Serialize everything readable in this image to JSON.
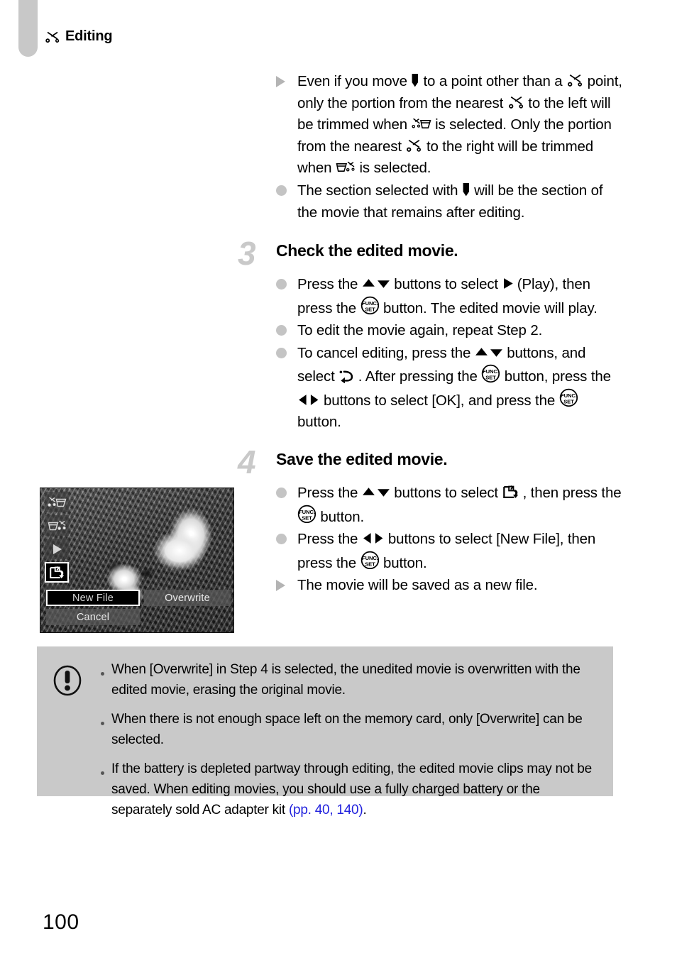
{
  "header": {
    "chapter_title": "Editing",
    "chapter_icon": "scissors-icon"
  },
  "body": {
    "note_bullets": [
      {
        "marker": "triangle",
        "segments": [
          {
            "t": "Even if you move "
          },
          {
            "icon": "cursor-marker-icon"
          },
          {
            "t": " to a point other than a "
          },
          {
            "icon": "scissors-icon"
          },
          {
            "t": " point, only the portion from the nearest "
          },
          {
            "icon": "scissors-icon"
          },
          {
            "t": " to the left will be trimmed when "
          },
          {
            "icon": "trim-beginning-icon"
          },
          {
            "t": " is selected. Only the portion from the nearest "
          },
          {
            "icon": "scissors-icon"
          },
          {
            "t": " to the right will be trimmed when "
          },
          {
            "icon": "trim-end-icon"
          },
          {
            "t": " is selected."
          }
        ]
      },
      {
        "marker": "dot",
        "segments": [
          {
            "t": "The section selected with "
          },
          {
            "icon": "cursor-marker-icon"
          },
          {
            "t": " will be the section of the movie that remains after editing."
          }
        ]
      }
    ]
  },
  "steps": [
    {
      "number": "3",
      "title": "Check the edited movie.",
      "bullets": [
        {
          "marker": "dot",
          "segments": [
            {
              "t": "Press the "
            },
            {
              "icon": "up-down-buttons-icon"
            },
            {
              "t": " buttons to select "
            },
            {
              "icon": "play-icon"
            },
            {
              "t": " (Play), then press the "
            },
            {
              "icon": "func-set-button-icon"
            },
            {
              "t": " button. The edited movie will play."
            }
          ]
        },
        {
          "marker": "dot",
          "segments": [
            {
              "t": "To edit the movie again, repeat Step 2."
            }
          ]
        },
        {
          "marker": "dot",
          "segments": [
            {
              "t": "To cancel editing, press the "
            },
            {
              "icon": "up-down-buttons-icon"
            },
            {
              "t": " buttons, and select "
            },
            {
              "icon": "return-arrow-icon"
            },
            {
              "t": " . After pressing the "
            },
            {
              "icon": "func-set-button-icon"
            },
            {
              "t": " button, press the "
            },
            {
              "icon": "left-right-buttons-icon"
            },
            {
              "t": " buttons to select [OK], and press the "
            },
            {
              "icon": "func-set-button-icon"
            },
            {
              "t": " button."
            }
          ]
        }
      ]
    },
    {
      "number": "4",
      "title": "Save the edited movie.",
      "bullets": [
        {
          "marker": "dot",
          "segments": [
            {
              "t": "Press the "
            },
            {
              "icon": "up-down-buttons-icon"
            },
            {
              "t": " buttons to select "
            },
            {
              "icon": "save-new-file-icon"
            },
            {
              "t": " , then press the "
            },
            {
              "icon": "func-set-button-icon"
            },
            {
              "t": " button."
            }
          ]
        },
        {
          "marker": "dot",
          "segments": [
            {
              "t": "Press the "
            },
            {
              "icon": "left-right-buttons-icon"
            },
            {
              "t": " buttons to select [New File], then press the "
            },
            {
              "icon": "func-set-button-icon"
            },
            {
              "t": " button."
            }
          ]
        },
        {
          "marker": "triangle",
          "segments": [
            {
              "t": "The movie will be saved as a new file."
            }
          ]
        }
      ]
    }
  ],
  "lcd_screen": {
    "icon_menu": [
      {
        "name": "trim-beginning-icon",
        "selected": false
      },
      {
        "name": "trim-end-icon",
        "selected": false
      },
      {
        "name": "play-icon",
        "selected": false
      },
      {
        "name": "save-new-file-icon",
        "selected": true
      },
      {
        "name": "return-arrow-icon",
        "selected": false
      }
    ],
    "buttons": {
      "new_file": "New File",
      "overwrite": "Overwrite",
      "cancel": "Cancel"
    },
    "photo_description": "Grayscale photo of a papillon dog lying in foliage"
  },
  "note_box": {
    "icon": "warning-exclamation-icon",
    "items": [
      {
        "segments": [
          {
            "t": "When [Overwrite] in Step 4 is selected, the unedited movie is overwritten with the edited movie, erasing the original movie."
          }
        ]
      },
      {
        "segments": [
          {
            "t": "When there is not enough space left on the memory card, only [Overwrite] can be selected."
          }
        ]
      },
      {
        "segments": [
          {
            "t": "If the battery is depleted partway through editing, the edited movie clips may not be saved. When editing movies, you should use a fully charged battery or the separately sold AC adapter kit "
          },
          {
            "t": "(pp. 40, 140)",
            "link": true
          },
          {
            "t": "."
          }
        ]
      }
    ]
  },
  "footer": {
    "page_number": "100"
  },
  "colors": {
    "tab_gray": "#c8c8c8",
    "step_number_gray": "#c9c9c9",
    "note_box_gray": "#c9c9c9",
    "link_blue": "#2222dd",
    "bullet_gray": "#c4c4c4"
  }
}
